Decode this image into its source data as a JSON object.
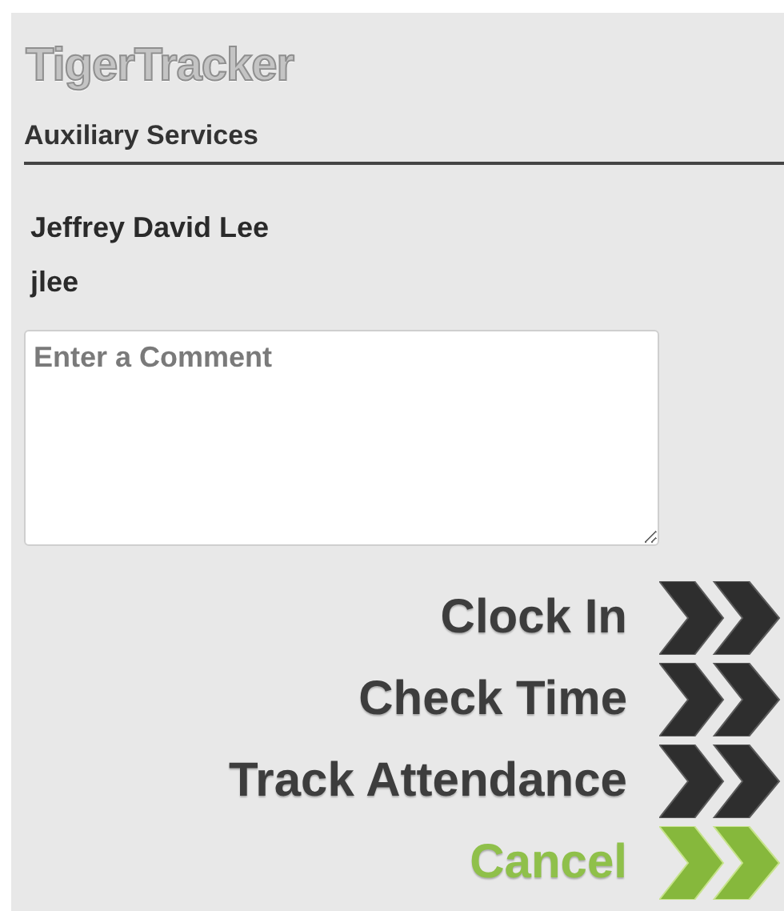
{
  "app": {
    "title": "TigerTracker"
  },
  "section": {
    "title": "Auxiliary Services"
  },
  "user": {
    "full_name": "Jeffrey David Lee",
    "username": "jlee"
  },
  "comment": {
    "placeholder": "Enter a Comment"
  },
  "actions": [
    {
      "label": "Clock In",
      "kind": "primary"
    },
    {
      "label": "Check Time",
      "kind": "primary"
    },
    {
      "label": "Track Attendance",
      "kind": "primary"
    },
    {
      "label": "Cancel",
      "kind": "cancel"
    }
  ]
}
